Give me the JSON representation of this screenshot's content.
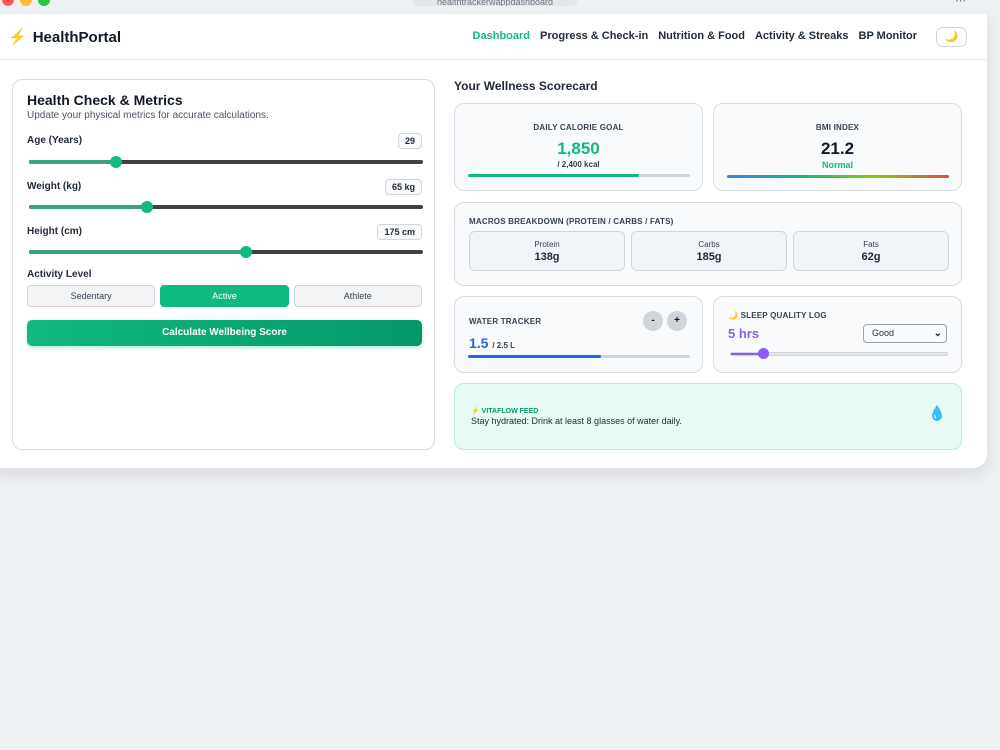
{
  "browser": {
    "url": "healthtrackerwappdashboard",
    "menu_icon": "more-icon"
  },
  "navbar": {
    "brand": "HealthPortal",
    "brand_icon": "⚡",
    "links": [
      "Dashboard",
      "Progress & Check-in",
      "Nutrition & Food",
      "Activity & Streaks",
      "BP Monitor"
    ],
    "active_link": "Dashboard",
    "theme_icon": "🌙",
    "accent": "#10b981"
  },
  "health_check": {
    "title": "Health Check & Metrics",
    "subtitle": "Update your physical metrics for accurate calculations.",
    "age": {
      "label": "Age (Years)",
      "value": "29",
      "level": 0.22
    },
    "weight": {
      "label": "Weight (kg)",
      "value": "65 kg",
      "level": 0.3
    },
    "height": {
      "label": "Height (cm)",
      "value": "175 cm",
      "level": 0.55
    },
    "activity_label": "Activity Level",
    "activity_options": [
      "Sedentary",
      "Active",
      "Athlete"
    ],
    "activity_selected": "Active",
    "calculate_label": "Calculate Wellbeing Score"
  },
  "scorecard": {
    "title": "Your Wellness Scorecard",
    "calorie": {
      "label": "DAILY CALORIE GOAL",
      "value": "1,850",
      "target": "/ 2,400 kcal",
      "progress": 0.77
    },
    "bmi": {
      "label": "BMI INDEX",
      "value": "21.2",
      "status": "Normal"
    },
    "macros": {
      "label": "MACROS BREAKDOWN (PROTEIN / CARBS / FATS)",
      "items": [
        {
          "name": "Protein",
          "value": "138g"
        },
        {
          "name": "Carbs",
          "value": "185g"
        },
        {
          "name": "Fats",
          "value": "62g"
        }
      ]
    },
    "water": {
      "label": "WATER TRACKER",
      "minus": "-",
      "plus": "+",
      "value": "1.5",
      "unit": "/ 2.5 L",
      "progress": 0.6
    },
    "sleep": {
      "icon": "🌙",
      "label": "SLEEP QUALITY LOG",
      "value": "5 hrs",
      "quality": "Good",
      "level": 0.15
    },
    "feed": {
      "icon": "⚡",
      "label": "VITAFLOW FEED",
      "message": "Stay hydrated: Drink at least 8 glasses of water daily."
    }
  }
}
